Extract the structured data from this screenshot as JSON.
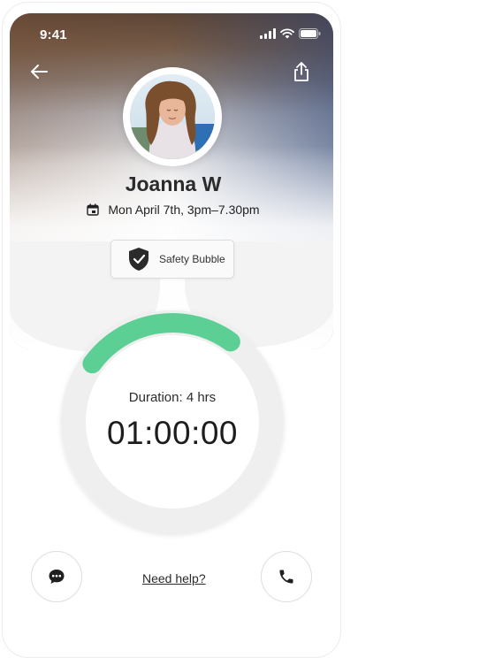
{
  "status_bar": {
    "time": "9:41",
    "icons": [
      "signal-icon",
      "wifi-icon",
      "battery-icon"
    ]
  },
  "header": {
    "back_icon": "arrow-left-icon",
    "share_icon": "share-icon"
  },
  "profile": {
    "name": "Joanna W",
    "date_icon": "calendar-icon",
    "datetime": "Mon April 7th, 3pm–7.30pm"
  },
  "safety": {
    "icon": "shield-check-icon",
    "label": "Safety Bubble"
  },
  "timer": {
    "duration_label": "Duration: 4 hrs",
    "elapsed": "01:00:00",
    "progress_fraction": 0.25,
    "progress_color": "#5ccf95",
    "track_color": "#efefef"
  },
  "footer": {
    "chat_icon": "chat-bubble-icon",
    "help_text": "Need help?",
    "phone_icon": "phone-icon"
  }
}
